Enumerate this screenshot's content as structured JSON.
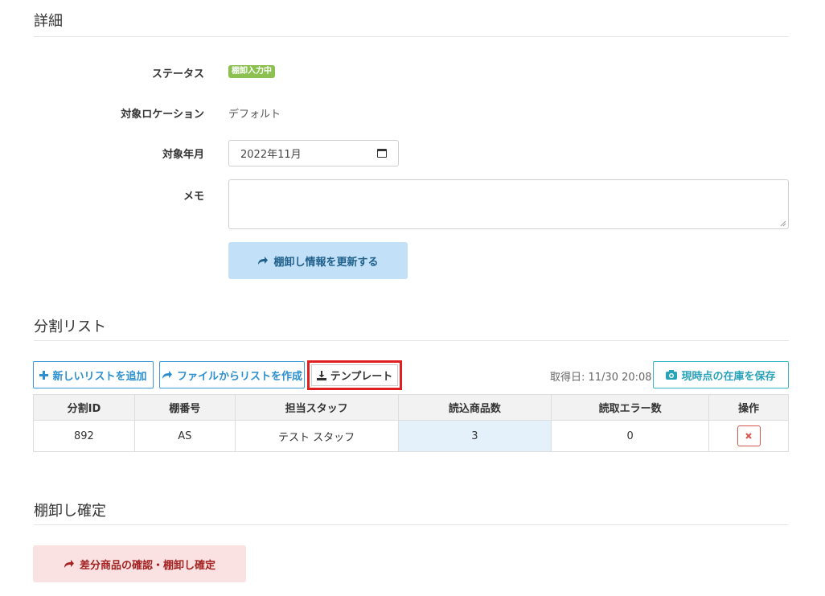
{
  "details": {
    "title": "詳細",
    "status_label": "ステータス",
    "status_badge": "棚卸入力中",
    "location_label": "対象ロケーション",
    "location_value": "デフォルト",
    "month_label": "対象年月",
    "month_value": "2022年11月",
    "memo_label": "メモ",
    "memo_value": "",
    "update_button": "棚卸し情報を更新する"
  },
  "split_list": {
    "title": "分割リスト",
    "add_button": "新しいリストを追加",
    "from_file_button": "ファイルからリストを作成",
    "template_button": "テンプレート",
    "fetch_date": "取得日: 11/30 20:08",
    "save_stock_button": "現時点の在庫を保存",
    "columns": [
      "分割ID",
      "棚番号",
      "担当スタッフ",
      "読込商品数",
      "読取エラー数",
      "操作"
    ],
    "rows": [
      {
        "id": "892",
        "shelf": "AS",
        "staff": "テスト スタッフ",
        "read_count": "3",
        "error_count": "0"
      }
    ]
  },
  "confirm": {
    "title": "棚卸し確定",
    "button": "差分商品の確認・棚卸し確定"
  },
  "colors": {
    "badge": "#8cc152",
    "primary": "#2b8fd0",
    "highlight_frame": "#e02020",
    "danger": "#d9534f",
    "info": "#29a3b9"
  }
}
